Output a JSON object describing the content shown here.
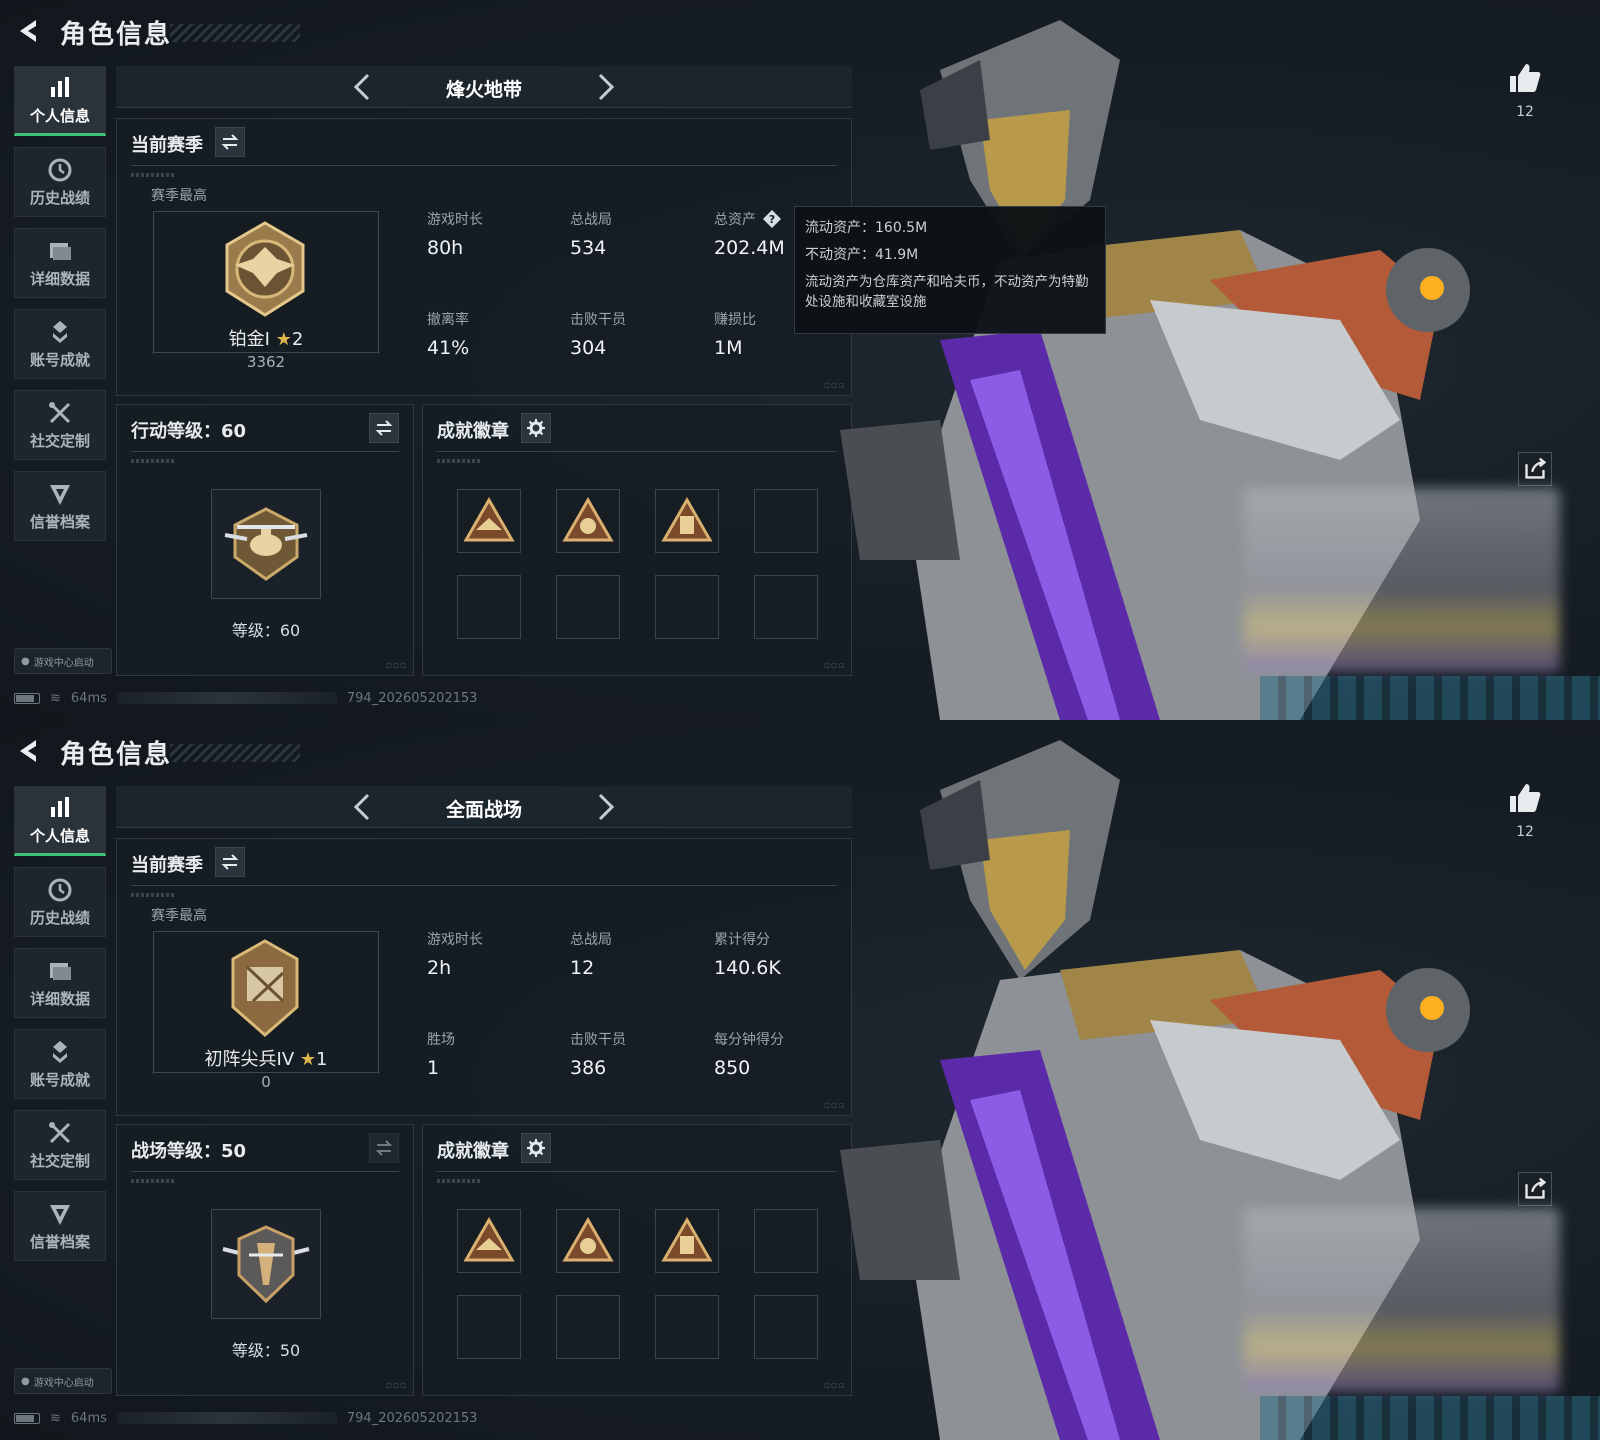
{
  "screens": [
    {
      "header": {
        "title": "角色信息"
      },
      "sidebar": {
        "items": [
          {
            "label": "个人信息",
            "icon": "bar-chart-icon",
            "active": true
          },
          {
            "label": "历史战绩",
            "icon": "clock-icon",
            "active": false
          },
          {
            "label": "详细数据",
            "icon": "folder-icon",
            "active": false
          },
          {
            "label": "账号成就",
            "icon": "achievement-icon",
            "active": false
          },
          {
            "label": "社交定制",
            "icon": "tools-icon",
            "active": false
          },
          {
            "label": "信誉档案",
            "icon": "shield-icon",
            "active": false
          }
        ]
      },
      "launch_badge": "游戏中心启动",
      "status": {
        "ping": "64ms",
        "build": "794_202605202153"
      },
      "mode": {
        "title": "烽火地带"
      },
      "season": {
        "title": "当前赛季",
        "best_label": "赛季最高",
        "rank_name": "铂金I",
        "rank_stars": "2",
        "rank_points": "3362",
        "stats": [
          {
            "label": "游戏时长",
            "value": "80h"
          },
          {
            "label": "总战局",
            "value": "534"
          },
          {
            "label": "总资产",
            "value": "202.4M",
            "help": true
          },
          {
            "label": "撤离率",
            "value": "41%"
          },
          {
            "label": "击败干员",
            "value": "304"
          },
          {
            "label": "赚损比",
            "value": "1M"
          }
        ]
      },
      "tooltip": {
        "line1": "流动资产：160.5M",
        "line2": "不动资产：41.9M",
        "desc": "流动资产为仓库资产和哈夫币，不动资产为特勤处设施和收藏室设施"
      },
      "level": {
        "title": "行动等级：60",
        "text": "等级：60"
      },
      "badges": {
        "title": "成就徽章"
      },
      "likes": "12"
    },
    {
      "header": {
        "title": "角色信息"
      },
      "sidebar": {
        "items": [
          {
            "label": "个人信息",
            "icon": "bar-chart-icon",
            "active": true
          },
          {
            "label": "历史战绩",
            "icon": "clock-icon",
            "active": false
          },
          {
            "label": "详细数据",
            "icon": "folder-icon",
            "active": false
          },
          {
            "label": "账号成就",
            "icon": "achievement-icon",
            "active": false
          },
          {
            "label": "社交定制",
            "icon": "tools-icon",
            "active": false
          },
          {
            "label": "信誉档案",
            "icon": "shield-icon",
            "active": false
          }
        ]
      },
      "launch_badge": "游戏中心启动",
      "status": {
        "ping": "64ms",
        "build": "794_202605202153"
      },
      "mode": {
        "title": "全面战场"
      },
      "season": {
        "title": "当前赛季",
        "best_label": "赛季最高",
        "rank_name": "初阵尖兵IV",
        "rank_stars": "1",
        "rank_points": "0",
        "stats": [
          {
            "label": "游戏时长",
            "value": "2h"
          },
          {
            "label": "总战局",
            "value": "12"
          },
          {
            "label": "累计得分",
            "value": "140.6K"
          },
          {
            "label": "胜场",
            "value": "1"
          },
          {
            "label": "击败干员",
            "value": "386"
          },
          {
            "label": "每分钟得分",
            "value": "850"
          }
        ]
      },
      "level": {
        "title": "战场等级：50",
        "text": "等级：50"
      },
      "badges": {
        "title": "成就徽章"
      },
      "likes": "12"
    }
  ],
  "colors": {
    "accent": "#3fc27a",
    "gold": "#e0b64a",
    "panel": "#161d24"
  }
}
